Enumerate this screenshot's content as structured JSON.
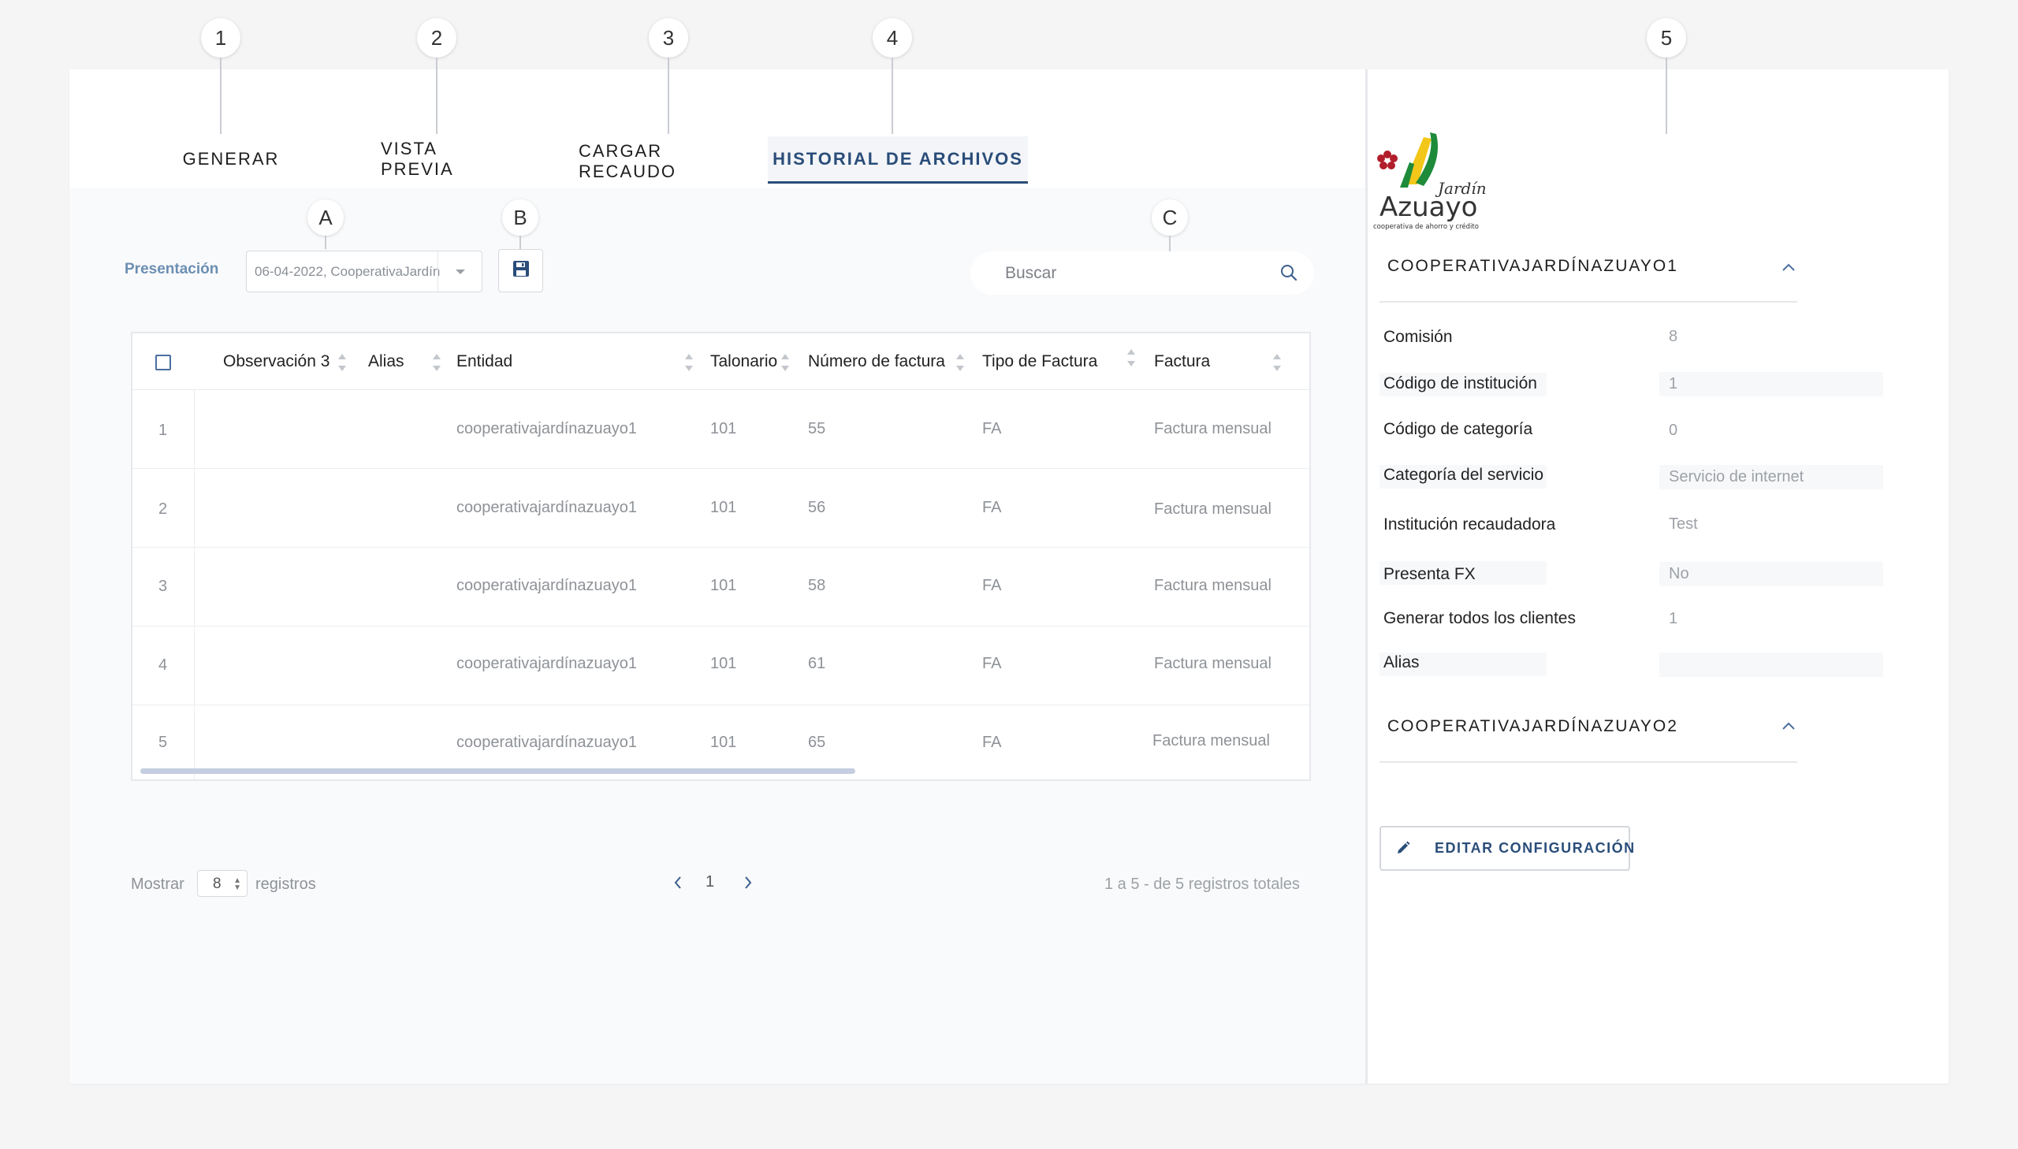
{
  "callouts": {
    "c1": "1",
    "c2": "2",
    "c3": "3",
    "c4": "4",
    "c5": "5",
    "cA": "A",
    "cB": "B",
    "cC": "C"
  },
  "tabs": [
    {
      "label": "GENERAR"
    },
    {
      "label": "VISTA PREVIA"
    },
    {
      "label": "CARGAR RECAUDO"
    },
    {
      "label": "HISTORIAL DE ARCHIVOS",
      "active": true
    }
  ],
  "filter": {
    "label": "Presentación",
    "selected": "06-04-2022, CooperativaJardín",
    "search_placeholder": "Buscar"
  },
  "table": {
    "columns": [
      "Observación 3",
      "Alias",
      "Entidad",
      "Talonario",
      "Número de factura",
      "Tipo de Factura",
      "Factura"
    ],
    "rows": [
      {
        "n": "1",
        "entidad": "cooperativajardínazuayo1",
        "talonario": "101",
        "numero": "55",
        "tipo": "FA",
        "factura": "Factura mensual"
      },
      {
        "n": "2",
        "entidad": "cooperativajardínazuayo1",
        "talonario": "101",
        "numero": "56",
        "tipo": "FA",
        "factura": "Factura mensual"
      },
      {
        "n": "3",
        "entidad": "cooperativajardínazuayo1",
        "talonario": "101",
        "numero": "58",
        "tipo": "FA",
        "factura": "Factura mensual"
      },
      {
        "n": "4",
        "entidad": "cooperativajardínazuayo1",
        "talonario": "101",
        "numero": "61",
        "tipo": "FA",
        "factura": "Factura mensual"
      },
      {
        "n": "5",
        "entidad": "cooperativajardínazuayo1",
        "talonario": "101",
        "numero": "65",
        "tipo": "FA",
        "factura": "Factura mensual"
      }
    ]
  },
  "pager": {
    "show_label": "Mostrar",
    "per_page": "8",
    "records_label": "registros",
    "current_page": "1",
    "summary": "1 a 5 - de 5 registros totales"
  },
  "panel": {
    "logo_text": "Jardín Azuayo",
    "logo_tagline": "cooperativa de ahorro y crédito",
    "section1_title": "COOPERATIVAJARDÍNAZUAYO1",
    "section2_title": "COOPERATIVAJARDÍNAZUAYO2",
    "fields": [
      {
        "key": "Comisión",
        "value": "8"
      },
      {
        "key": "Código de institución",
        "value": "1"
      },
      {
        "key": "Código de categoría",
        "value": "0"
      },
      {
        "key": "Categoría del servicio",
        "value": "Servicio de internet"
      },
      {
        "key": "Institución recaudadora",
        "value": "Test"
      },
      {
        "key": "Presenta FX",
        "value": "No"
      },
      {
        "key": "Generar todos los clientes",
        "value": "1"
      },
      {
        "key": "Alias",
        "value": ""
      }
    ],
    "edit_button": "EDITAR CONFIGURACIÓN"
  },
  "colors": {
    "accent": "#2a4d79",
    "label_blue": "#6c8fb3",
    "logo_yellow": "#f2c71a",
    "logo_green": "#1e8b3a",
    "logo_red": "#b21e2b"
  }
}
